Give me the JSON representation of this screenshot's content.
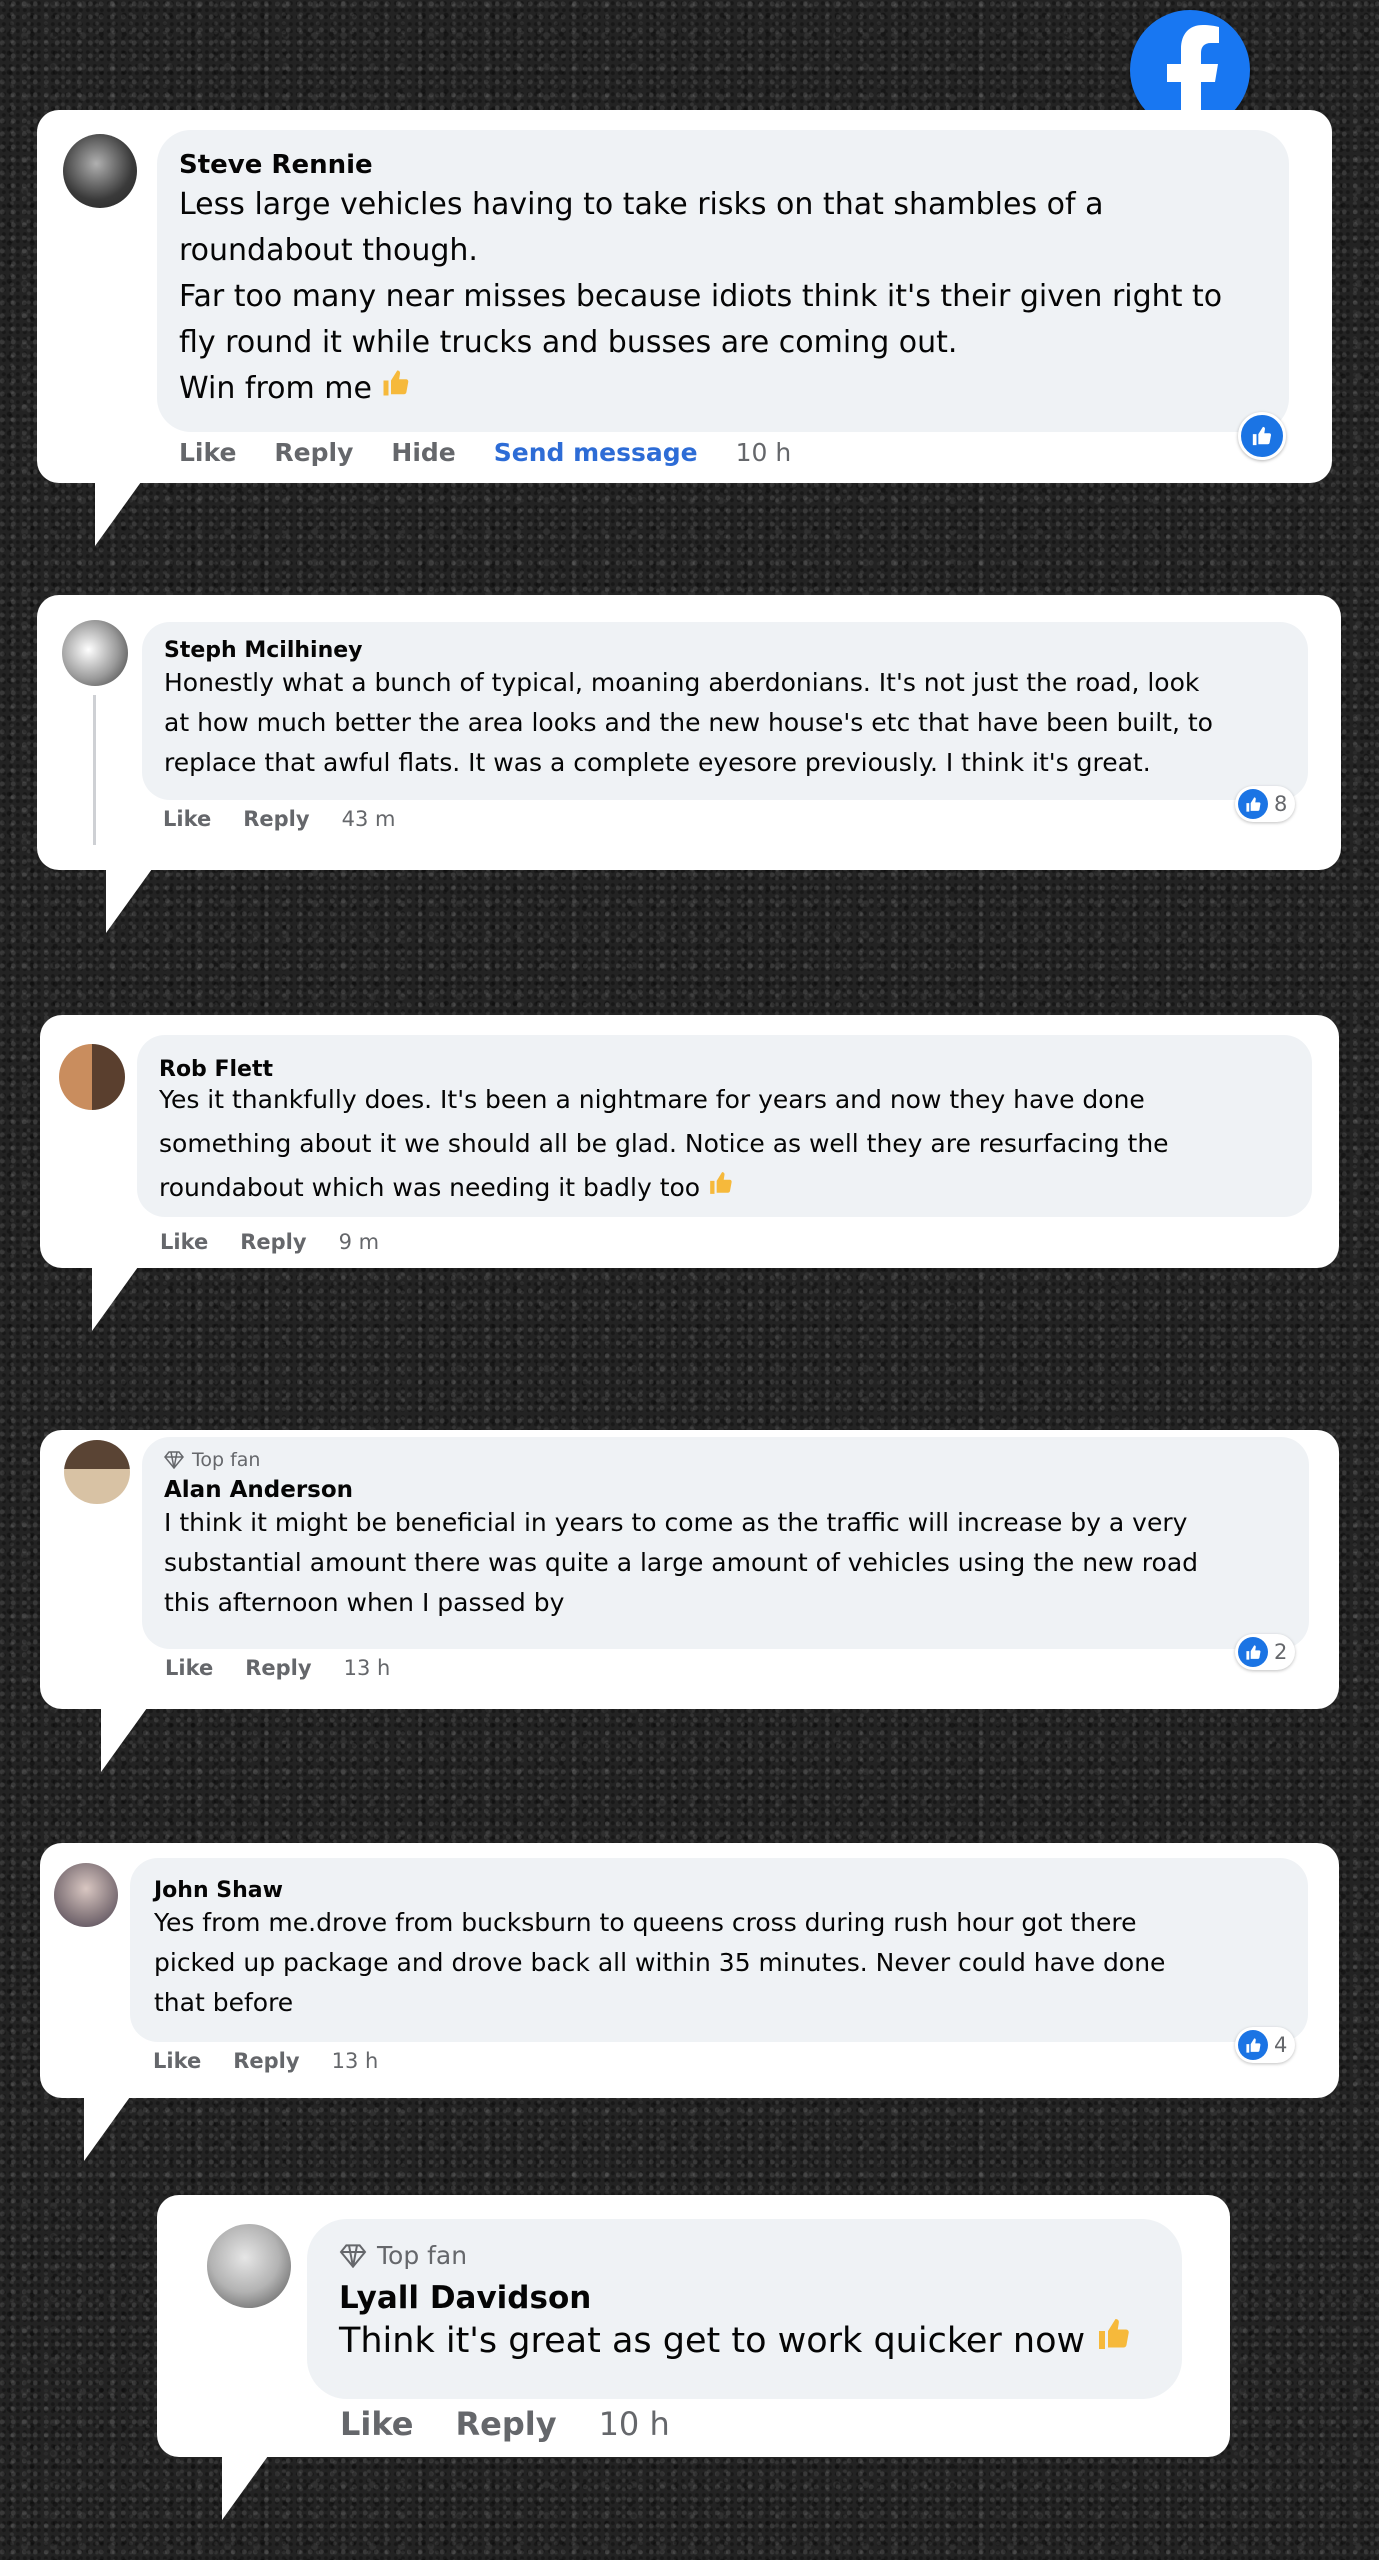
{
  "app": {
    "logo_icon": "facebook-logo-icon",
    "accent_color": "#1877f2"
  },
  "actions": {
    "like": "Like",
    "reply": "Reply",
    "hide": "Hide",
    "send_message": "Send message"
  },
  "badges": {
    "top_fan": "Top fan"
  },
  "comments": [
    {
      "author": "Steve Rennie",
      "lines": [
        "Less large vehicles having to take risks on that shambles of a",
        "roundabout though.",
        "Far too many near misses because idiots think it's their given right to",
        "fly round it while trucks and busses are coming out.",
        "Win from me"
      ],
      "time": "10 h",
      "reaction_icon": "like-icon"
    },
    {
      "author": "Steph Mcilhiney",
      "lines": [
        "Honestly what a bunch of typical, moaning aberdonians. It's not just the road, look",
        "at how much better the area looks and the new house's etc that have been built, to",
        "replace that awful flats. It was a complete eyesore previously. I think it's great."
      ],
      "time": "43 m",
      "reactions": "8"
    },
    {
      "author": "Rob Flett",
      "lines": [
        "Yes it thankfully does. It's been a nightmare for years and now they have done",
        "something about it we should all be glad. Notice as well they are resurfacing the",
        "roundabout which was needing it badly too"
      ],
      "time": "9 m"
    },
    {
      "author": "Alan Anderson",
      "lines": [
        "I think it might be beneficial in years to come as the traffic will increase by a very",
        "substantial amount there was quite a large amount of vehicles using the new road",
        "this afternoon when I passed by"
      ],
      "time": "13 h",
      "reactions": "2"
    },
    {
      "author": "John Shaw",
      "lines": [
        "Yes from me.drove from bucksburn to queens cross during rush hour got there",
        "picked up package and drove back all within 35 minutes. Never could have done",
        "that before"
      ],
      "time": "13 h",
      "reactions": "4"
    },
    {
      "author": "Lyall Davidson",
      "lines": [
        "Think it's great as get to work quicker now"
      ],
      "time": "10 h"
    }
  ]
}
